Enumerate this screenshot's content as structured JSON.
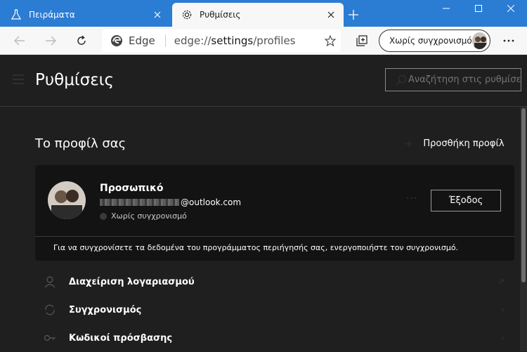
{
  "tabs": [
    {
      "title": "Πειράματα",
      "icon": "flask-icon",
      "active": false
    },
    {
      "title": "Ρυθμίσεις",
      "icon": "gear-icon",
      "active": true
    }
  ],
  "toolbar": {
    "site_label": "Edge",
    "url_prefix": "edge://",
    "url_host": "settings",
    "url_path": "/profiles",
    "profile_pill_label": "Χωρίς συγχρονισμό"
  },
  "settings": {
    "title": "Ρυθμίσεις",
    "search_placeholder": "Αναζήτηση στις ρυθμίσεις"
  },
  "profile_section": {
    "title": "Το προφίλ σας",
    "add_profile_label": "Προσθήκη προφίλ",
    "profile_name": "Προσωπικό",
    "email_domain": "@outlook.com",
    "sync_status": "Χωρίς συγχρονισμό",
    "more_label": "···",
    "signout_label": "Έξοδος",
    "sync_note": "Για να συγχρονίσετε τα δεδομένα του προγράμματος περιήγησής σας, ενεργοποιήστε τον συγχρονισμό."
  },
  "menu_items": [
    {
      "label": "Διαχείριση λογαριασμού",
      "icon": "account-icon"
    },
    {
      "label": "Συγχρονισμός",
      "icon": "sync-icon"
    },
    {
      "label": "Κωδικοί πρόσβασης",
      "icon": "key-icon"
    }
  ],
  "colors": {
    "titlebar": "#2b7cd3",
    "background": "#1f1f1f",
    "card": "#131313"
  }
}
